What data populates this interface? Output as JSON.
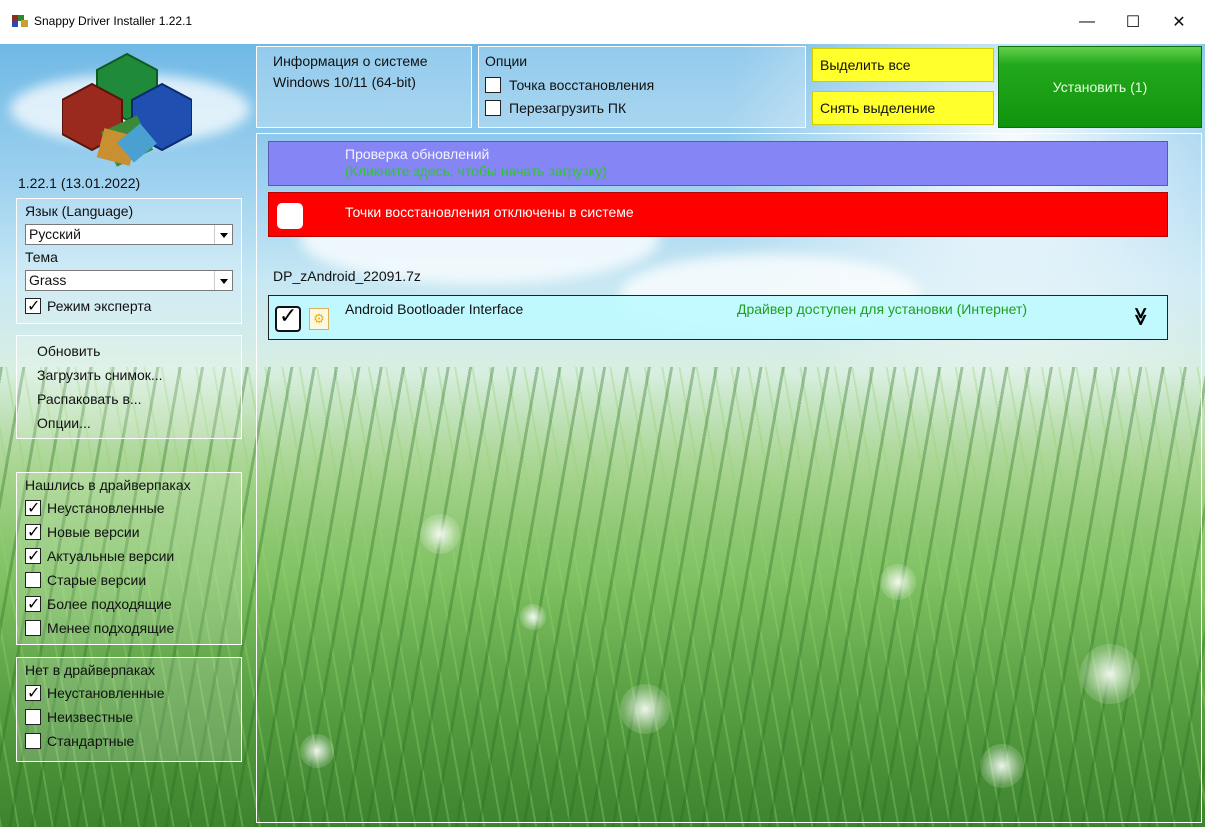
{
  "window": {
    "title": "Snappy Driver Installer 1.22.1",
    "minimize": "—",
    "maximize": "☐",
    "close": "✕"
  },
  "left": {
    "version": "1.22.1 (13.01.2022)",
    "language_label": "Язык (Language)",
    "language_value": "Русский",
    "theme_label": "Тема",
    "theme_value": "Grass",
    "expert_mode": {
      "label": "Режим эксперта",
      "checked": true
    },
    "menu": [
      "Обновить",
      "Загрузить снимок...",
      "Распаковать в...",
      "Опции..."
    ],
    "found_group": {
      "title": "Нашлись в драйверпаках",
      "items": [
        {
          "label": "Неустановленные",
          "checked": true
        },
        {
          "label": "Новые версии",
          "checked": true
        },
        {
          "label": "Актуальные версии",
          "checked": true
        },
        {
          "label": "Старые версии",
          "checked": false
        },
        {
          "label": "Более подходящие",
          "checked": true
        },
        {
          "label": "Менее подходящие",
          "checked": false
        }
      ]
    },
    "notfound_group": {
      "title": "Нет в драйверпаках",
      "items": [
        {
          "label": "Неустановленные",
          "checked": true
        },
        {
          "label": "Неизвестные",
          "checked": false
        },
        {
          "label": "Стандартные",
          "checked": false
        }
      ]
    }
  },
  "top": {
    "sysinfo_title": "Информация о системе",
    "sysinfo_os": "Windows 10/11 (64-bit)",
    "options_title": "Опции",
    "restore_point": {
      "label": "Точка восстановления",
      "checked": false
    },
    "reboot": {
      "label": "Перезагрузить ПК",
      "checked": false
    },
    "select_all": "Выделить все",
    "deselect": "Снять выделение",
    "install": "Установить (1)"
  },
  "main": {
    "update_title": "Проверка обновлений",
    "update_subtitle": "(Кликните здесь, чтобы начать загрузку)",
    "restore_warning": "Точки восстановления отключены в системе",
    "pack_name": "DP_zAndroid_22091.7z",
    "driver": {
      "name": "Android Bootloader Interface",
      "status": "Драйвер доступен для установки (Интернет)",
      "checked": true,
      "expand_icon": "chevron-double-down-icon"
    }
  },
  "colors": {
    "update_bar": "#8585f5",
    "warning_bar": "#ff0000",
    "select_buttons": "#ffff2b",
    "install_button": "#1a9e16",
    "driver_row": "#bffaff",
    "status_text": "#1f9f1f"
  }
}
